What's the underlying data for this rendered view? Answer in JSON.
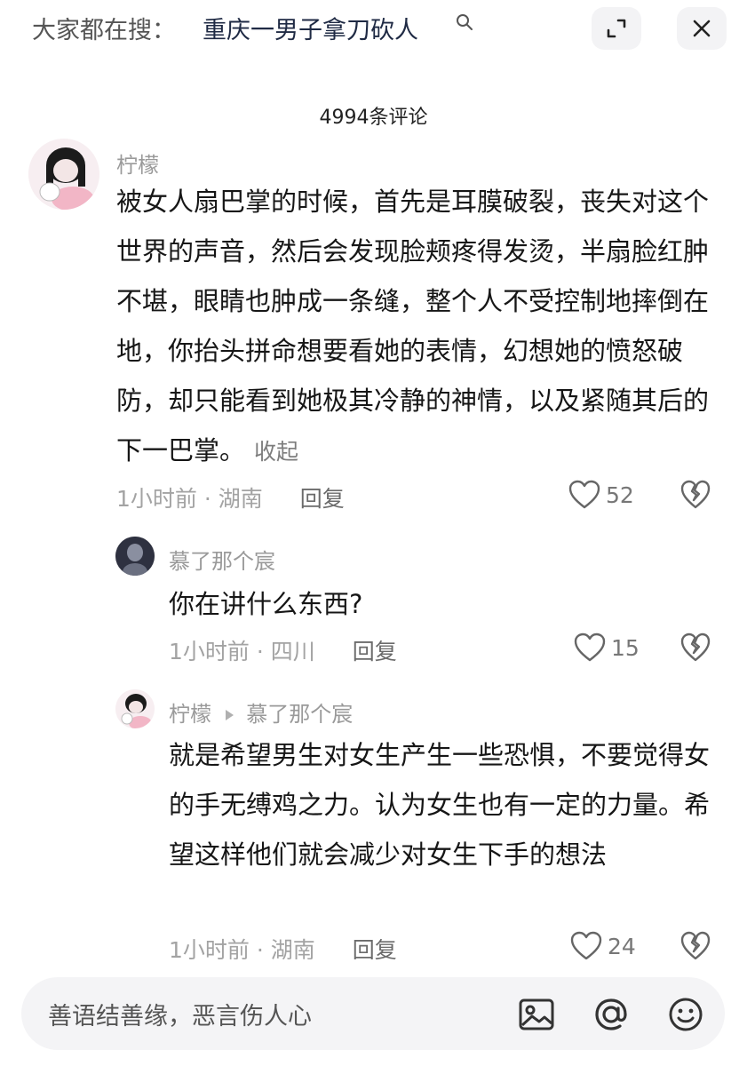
{
  "search_bar": {
    "prefix": "大家都在搜：",
    "query": "重庆一男子拿刀砍人"
  },
  "comment_count_label": "4994条评论",
  "comments": [
    {
      "username": "柠檬",
      "text": "被女人扇巴掌的时候，首先是耳膜破裂，丧失对这个世界的声音，然后会发现脸颊疼得发烫，半扇脸红肿不堪，眼睛也肿成一条缝，整个人不受控制地摔倒在地，你抬头拼命想要看她的表情，幻想她的愤怒破防，却只能看到她极其冷静的神情，以及紧随其后的下一巴掌。",
      "collapse_label": "收起",
      "time": "1小时前",
      "location": "湖南",
      "reply_label": "回复",
      "likes": "52"
    },
    {
      "username": "慕了那个宸",
      "text": "你在讲什么东西?",
      "time": "1小时前",
      "location": "四川",
      "reply_label": "回复",
      "likes": "15"
    },
    {
      "username": "柠檬",
      "reply_to": "慕了那个宸",
      "text": "就是希望男生对女生产生一些恐惧，不要觉得女的手无缚鸡之力。认为女生也有一定的力量。希望这样他们就会减少对女生下手的想法",
      "time": "1小时前",
      "location": "湖南",
      "reply_label": "回复",
      "likes": "24"
    }
  ],
  "input_bar": {
    "placeholder": "善语结善缘，恶言伤人心"
  },
  "icons": {
    "search": "search-icon",
    "expand": "expand-icon",
    "close": "close-icon",
    "like": "heart-icon",
    "dislike": "broken-heart-icon",
    "image": "image-icon",
    "mention": "at-icon",
    "emoji": "emoji-icon"
  },
  "colors": {
    "text_primary": "#161616",
    "text_secondary": "#9a9a9a",
    "avatar_pink": "#f2b6c6",
    "input_bg": "#f4f4f6"
  }
}
